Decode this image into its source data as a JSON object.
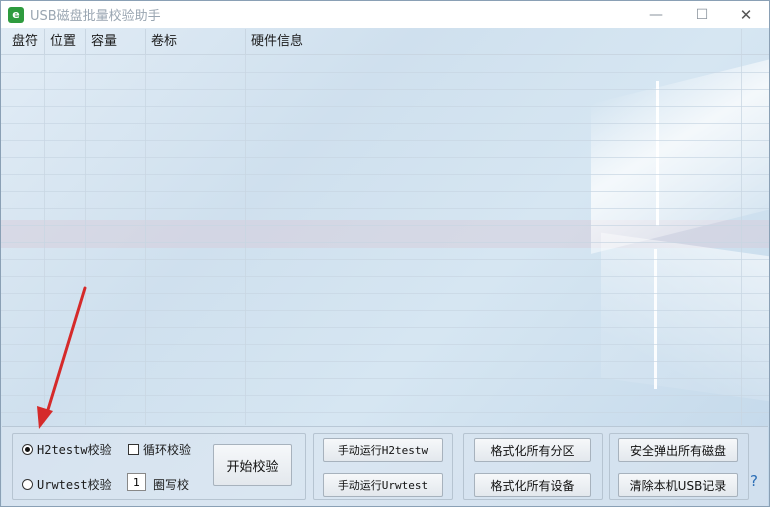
{
  "window": {
    "title": "USB磁盘批量校验助手",
    "app_icon_glyph": "e",
    "controls": {
      "minimize": "—",
      "maximize": "☐",
      "close": "✕"
    }
  },
  "table": {
    "columns": [
      "盘符",
      "位置",
      "容量",
      "卷标",
      "硬件信息"
    ],
    "rows": []
  },
  "options": {
    "mode_h2testw": "H2testw校验",
    "mode_urwtest": "Urwtest校验",
    "selected_mode": "H2testw校验",
    "loop_check_label": "循环校验",
    "loop_checked": false,
    "write_count": "1",
    "write_count_suffix": "圈写校"
  },
  "buttons": {
    "start_check": "开始校验",
    "run_h2testw": "手动运行H2testw",
    "run_urwtest": "手动运行Urwtest",
    "format_partitions": "格式化所有分区",
    "format_devices": "格式化所有设备",
    "eject_all": "安全弹出所有磁盘",
    "clear_usb_records": "清除本机USB记录"
  },
  "help": {
    "label": "?"
  },
  "colors": {
    "annotation_arrow": "#d52a2a",
    "app_icon": "#2e9b3e",
    "help": "#2d6fb6"
  }
}
